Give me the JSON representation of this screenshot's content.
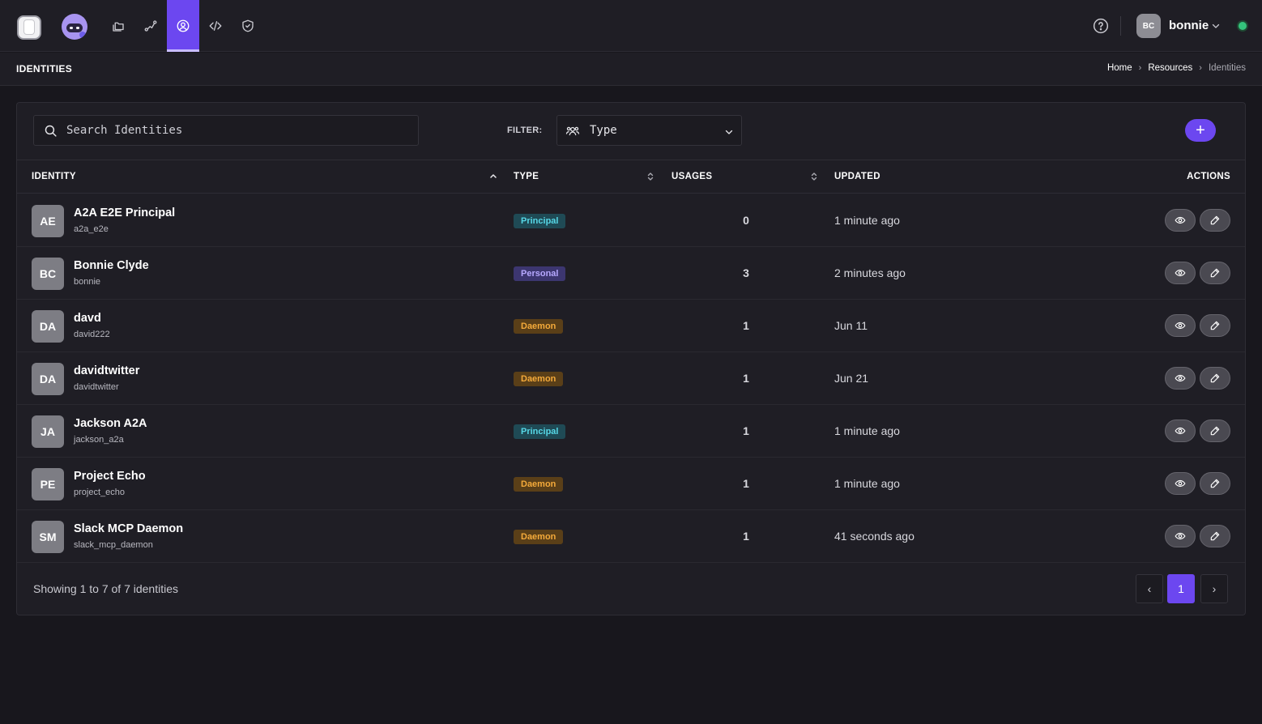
{
  "nav": {
    "items": [
      {
        "name": "resources",
        "icon": "folders-icon"
      },
      {
        "name": "connections",
        "icon": "route-icon"
      },
      {
        "name": "identities",
        "icon": "user-circle-icon",
        "active": true
      },
      {
        "name": "code",
        "icon": "code-icon"
      },
      {
        "name": "security",
        "icon": "shield-check-icon"
      }
    ]
  },
  "user": {
    "initials": "BC",
    "name": "bonnie",
    "status": "online"
  },
  "header": {
    "title": "IDENTITIES"
  },
  "breadcrumb": {
    "home": "Home",
    "resources": "Resources",
    "current": "Identities"
  },
  "toolbar": {
    "search_placeholder": "Search Identities",
    "filter_label": "FILTER:",
    "filter_value": "Type",
    "add_label": "+"
  },
  "table": {
    "columns": {
      "identity": "IDENTITY",
      "type": "TYPE",
      "usages": "USAGES",
      "updated": "UPDATED",
      "actions": "ACTIONS"
    },
    "rows": [
      {
        "initials": "AE",
        "name": "A2A E2E Principal",
        "handle": "a2a_e2e",
        "type": "Principal",
        "type_key": "principal",
        "usages": "0",
        "updated": "1 minute ago"
      },
      {
        "initials": "BC",
        "name": "Bonnie Clyde",
        "handle": "bonnie",
        "type": "Personal",
        "type_key": "personal",
        "usages": "3",
        "updated": "2 minutes ago"
      },
      {
        "initials": "DA",
        "name": "davd",
        "handle": "david222",
        "type": "Daemon",
        "type_key": "daemon",
        "usages": "1",
        "updated": "Jun 11"
      },
      {
        "initials": "DA",
        "name": "davidtwitter",
        "handle": "davidtwitter",
        "type": "Daemon",
        "type_key": "daemon",
        "usages": "1",
        "updated": "Jun 21"
      },
      {
        "initials": "JA",
        "name": "Jackson A2A",
        "handle": "jackson_a2a",
        "type": "Principal",
        "type_key": "principal",
        "usages": "1",
        "updated": "1 minute ago"
      },
      {
        "initials": "PE",
        "name": "Project Echo",
        "handle": "project_echo",
        "type": "Daemon",
        "type_key": "daemon",
        "usages": "1",
        "updated": "1 minute ago"
      },
      {
        "initials": "SM",
        "name": "Slack MCP Daemon",
        "handle": "slack_mcp_daemon",
        "type": "Daemon",
        "type_key": "daemon",
        "usages": "1",
        "updated": "41 seconds ago"
      }
    ]
  },
  "footer": {
    "summary": "Showing 1 to 7 of 7 identities"
  },
  "pagination": {
    "prev": "‹",
    "current": "1",
    "next": "›"
  },
  "colors": {
    "accent": "#6c47f0",
    "principal": "#56d7e6",
    "personal": "#b6a8ff",
    "daemon": "#f4aa3a",
    "status_online": "#34c47c"
  }
}
